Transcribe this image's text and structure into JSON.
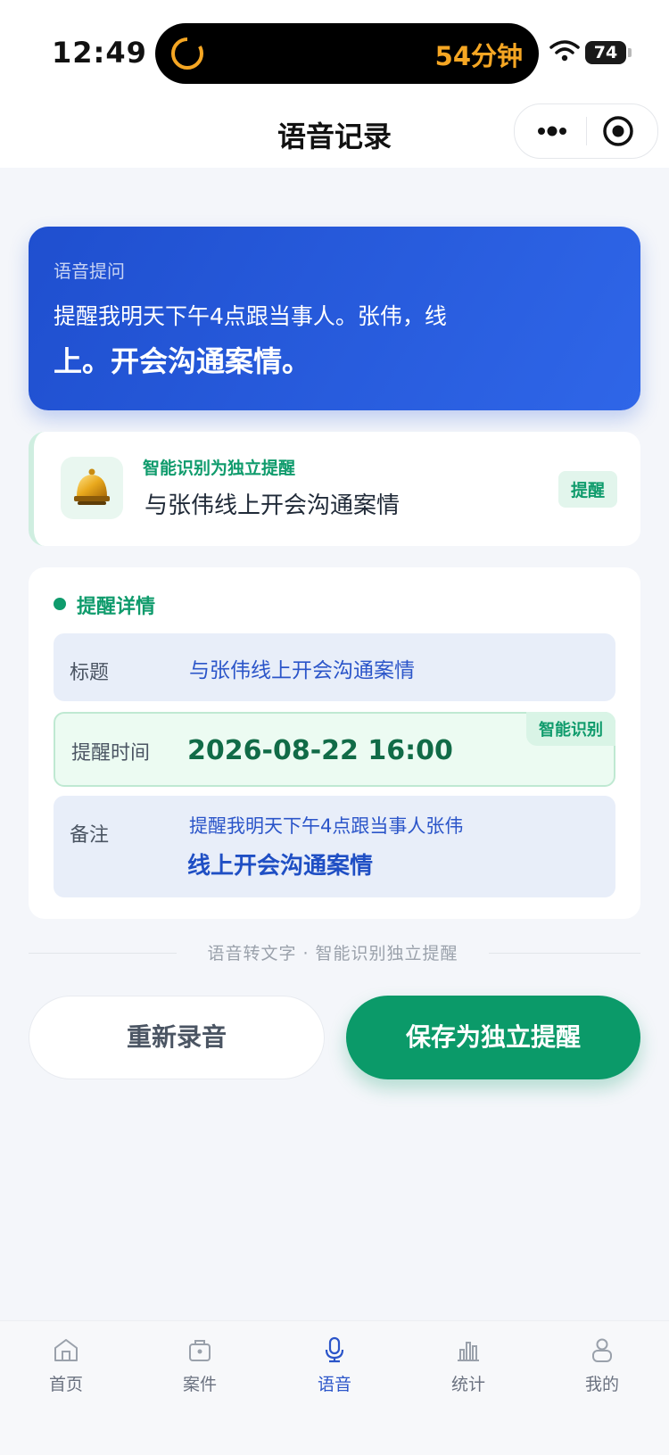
{
  "status_bar": {
    "time": "12:49",
    "live_activity_text": "54分钟",
    "battery": "74"
  },
  "nav": {
    "title": "语音记录"
  },
  "voice_card": {
    "label": "语音提问",
    "line1": "提醒我明天下午4点跟当事人。张伟，线",
    "line2": "上。开会沟通案情。"
  },
  "recognition": {
    "tag": "智能识别为独立提醒",
    "title": "与张伟线上开会沟通案情",
    "badge": "提醒"
  },
  "details": {
    "heading": "提醒详情",
    "title_label": "标题",
    "title_value": "与张伟线上开会沟通案情",
    "time_label": "提醒时间",
    "time_value": "2026-08-22 16:00",
    "time_badge": "智能识别",
    "note_label": "备注",
    "note_line1": "提醒我明天下午4点跟当事人张伟",
    "note_line2": "线上开会沟通案情"
  },
  "separator_text": "语音转文字 · 智能识别独立提醒",
  "actions": {
    "rerecord": "重新录音",
    "save": "保存为独立提醒"
  },
  "tabbar": {
    "items": [
      {
        "label": "首页",
        "icon": "home-icon"
      },
      {
        "label": "案件",
        "icon": "case-icon"
      },
      {
        "label": "语音",
        "icon": "microphone-icon",
        "active": true
      },
      {
        "label": "统计",
        "icon": "stats-icon"
      },
      {
        "label": "我的",
        "icon": "user-icon"
      }
    ]
  },
  "colors": {
    "primary_blue": "#2f66e8",
    "primary_green": "#0b9a69",
    "timer_orange": "#f5a623"
  }
}
